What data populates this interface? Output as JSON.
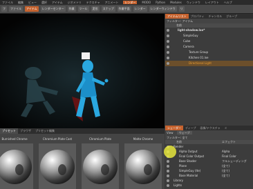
{
  "menubar": {
    "items": [
      "ファイル",
      "編集",
      "ビュー",
      "選択",
      "アイテム",
      "ジオメトリ",
      "テクスチャ",
      "アニメート",
      "レンダー",
      "MODO",
      "Python",
      "Modules",
      "ウィンドウ",
      "レイアウト",
      "ヘルプ"
    ],
    "active_index": 8,
    "accent": "#c5622e"
  },
  "toolbar": {
    "buttons": [
      {
        "label": "フ",
        "on": false
      },
      {
        "label": "ファイル",
        "on": false
      },
      {
        "label": "アイテム",
        "on": true
      },
      {
        "label": "レンダーセンター",
        "on": false
      },
      {
        "label": "作業",
        "on": false
      },
      {
        "label": "ツール",
        "on": false
      },
      {
        "label": "変形",
        "on": false
      },
      {
        "label": "スナップ",
        "on": false
      },
      {
        "label": "作業平面",
        "on": false
      },
      {
        "label": "レンダー",
        "on": false
      },
      {
        "label": "レンダーウィンドウ",
        "on": false
      },
      {
        "label": "リ",
        "on": false
      }
    ]
  },
  "viewport": {
    "background": "#050505",
    "figure_color": "#2aa8e0"
  },
  "item_list": {
    "tabs": [
      "アイテムリスト",
      "プロパティ",
      "チャンネル",
      "グループ"
    ],
    "active_tab": 0,
    "filter_label": "フィルター: アイテム",
    "columns": [
      "名前"
    ],
    "rows": [
      {
        "label": "light-shadow.lxo*",
        "indent": 1,
        "selected": false,
        "bold": true
      },
      {
        "label": "SimpleGuy",
        "indent": 2,
        "selected": false
      },
      {
        "label": "Cube",
        "indent": 2,
        "selected": false
      },
      {
        "label": "Camera",
        "indent": 2,
        "selected": false
      },
      {
        "label": "Texture Group",
        "indent": 3,
        "selected": false
      },
      {
        "label": "Kitchen 01.lxe",
        "indent": 3,
        "selected": false
      },
      {
        "label": "Directional Light",
        "indent": 3,
        "selected": true
      }
    ]
  },
  "bottom_tabs": {
    "items": [
      "プリセット",
      "ブラウザ",
      "プリセット編集"
    ],
    "active": 0
  },
  "presets": [
    {
      "name": "Burnished Chrome"
    },
    {
      "name": "Chromium Plate Cast"
    },
    {
      "name": "Chromium Plate"
    },
    {
      "name": "Matte Chrome"
    }
  ],
  "shader_tree": {
    "tabs": [
      "シェーダー",
      "ディープ",
      "画像/テクスチャ",
      "ミ"
    ],
    "active_tab": 0,
    "view_label": "View",
    "view_value": "ウェーブ",
    "filter_label": "フィルター: 全て",
    "columns": [
      "名前",
      "エフェクト"
    ],
    "rows": [
      {
        "label": "Render",
        "effect": "",
        "indent": 0
      },
      {
        "label": "Alpha Output",
        "effect": "Alpha",
        "indent": 1
      },
      {
        "label": "Final Color Output",
        "effect": "Final Color",
        "indent": 1
      },
      {
        "label": "Base Shader",
        "effect": "フルシェーディング",
        "indent": 1
      },
      {
        "label": "Plane",
        "effect": "(全て)",
        "indent": 1
      },
      {
        "label": "SimpleGuy (Ite)",
        "effect": "(全て)",
        "indent": 1
      },
      {
        "label": "Base Material",
        "effect": "(全て)",
        "indent": 1
      },
      {
        "label": "Library",
        "effect": "",
        "indent": 0
      },
      {
        "label": "Lights",
        "effect": "",
        "indent": 0
      }
    ]
  }
}
